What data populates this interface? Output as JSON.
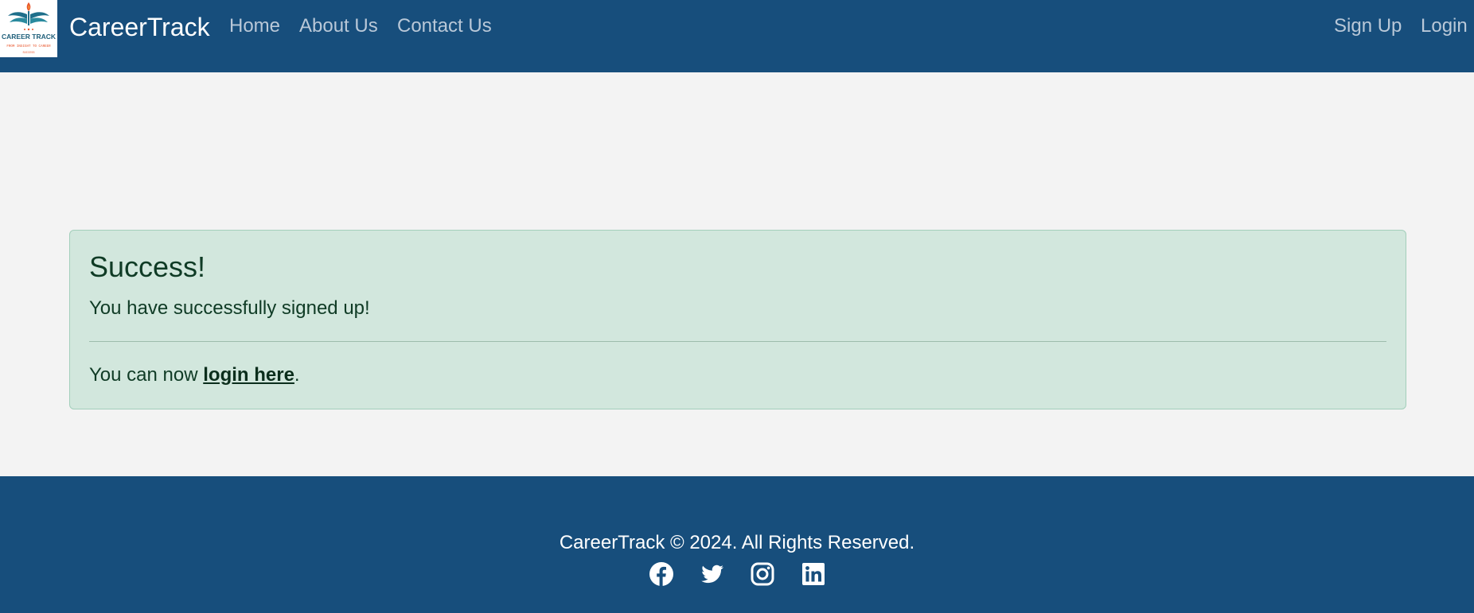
{
  "header": {
    "logo": {
      "text": "CAREER TRACK",
      "icon": "career-track-logo",
      "tagline": "FROM INSIGHT TO CAREER",
      "subtagline": "SUCCESS"
    },
    "brand": "CareerTrack",
    "nav": {
      "home": "Home",
      "about": "About Us",
      "contact": "Contact Us",
      "signup": "Sign Up",
      "login": "Login"
    }
  },
  "alert": {
    "heading": "Success!",
    "message": "You have successfully signed up!",
    "footer_prefix": "You can now ",
    "link_text": "login here",
    "footer_suffix": "."
  },
  "footer": {
    "copyright": "CareerTrack © 2024. All Rights Reserved.",
    "social": [
      "facebook-icon",
      "twitter-icon",
      "instagram-icon",
      "linkedin-icon"
    ]
  },
  "colors": {
    "navbar": "#174e7c",
    "page_bg": "#f3f3f3",
    "alert_bg": "#d2e7dd",
    "alert_border": "#a3cfbb",
    "alert_text": "#0f3b25",
    "nav_link": "#b9c8d8"
  }
}
